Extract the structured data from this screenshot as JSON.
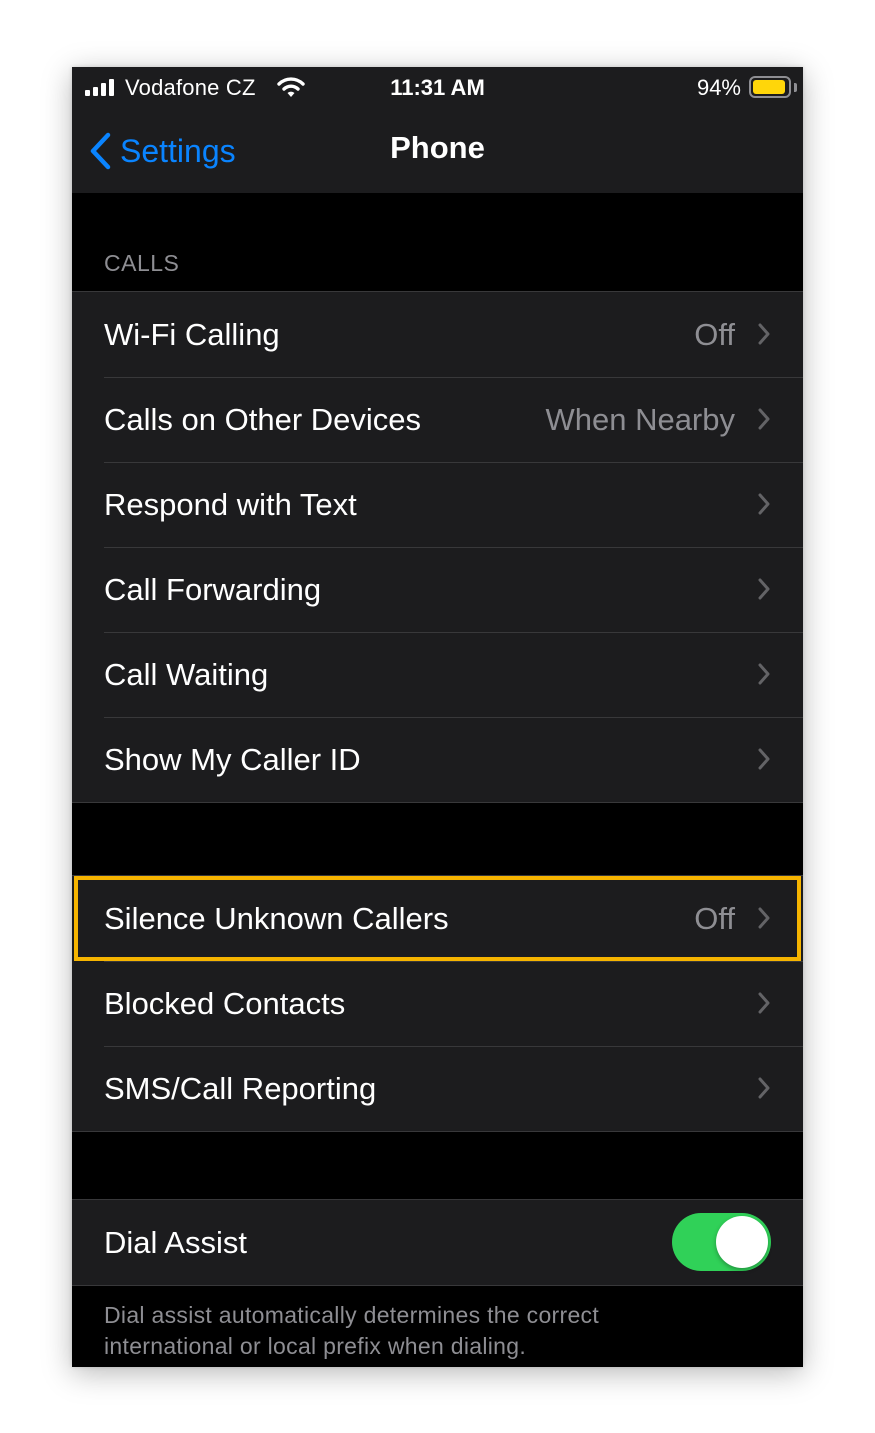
{
  "status_bar": {
    "carrier": "Vodafone CZ",
    "time": "11:31 AM",
    "battery_percent": "94%",
    "battery_level": 0.94,
    "battery_color": "#ffd60a"
  },
  "nav": {
    "back_label": "Settings",
    "title": "Phone"
  },
  "sections": {
    "calls_header": "CALLS"
  },
  "calls_rows": [
    {
      "label": "Wi-Fi Calling",
      "value": "Off"
    },
    {
      "label": "Calls on Other Devices",
      "value": "When Nearby"
    },
    {
      "label": "Respond with Text"
    },
    {
      "label": "Call Forwarding"
    },
    {
      "label": "Call Waiting"
    },
    {
      "label": "Show My Caller ID"
    }
  ],
  "block_rows": [
    {
      "label": "Silence Unknown Callers",
      "value": "Off",
      "highlighted": true
    },
    {
      "label": "Blocked Contacts"
    },
    {
      "label": "SMS/Call Reporting"
    }
  ],
  "dial_assist": {
    "label": "Dial Assist",
    "enabled": true,
    "footer_line1": "Dial assist automatically determines the correct",
    "footer_line2": "international or local prefix when dialing."
  },
  "colors": {
    "accent": "#0a84ff",
    "toggle_on": "#30d158",
    "highlight": "#f6b400"
  },
  "icons": [
    "signal-icon",
    "wifi-icon",
    "battery-icon",
    "back-chevron-icon",
    "chevron-right-icon"
  ]
}
